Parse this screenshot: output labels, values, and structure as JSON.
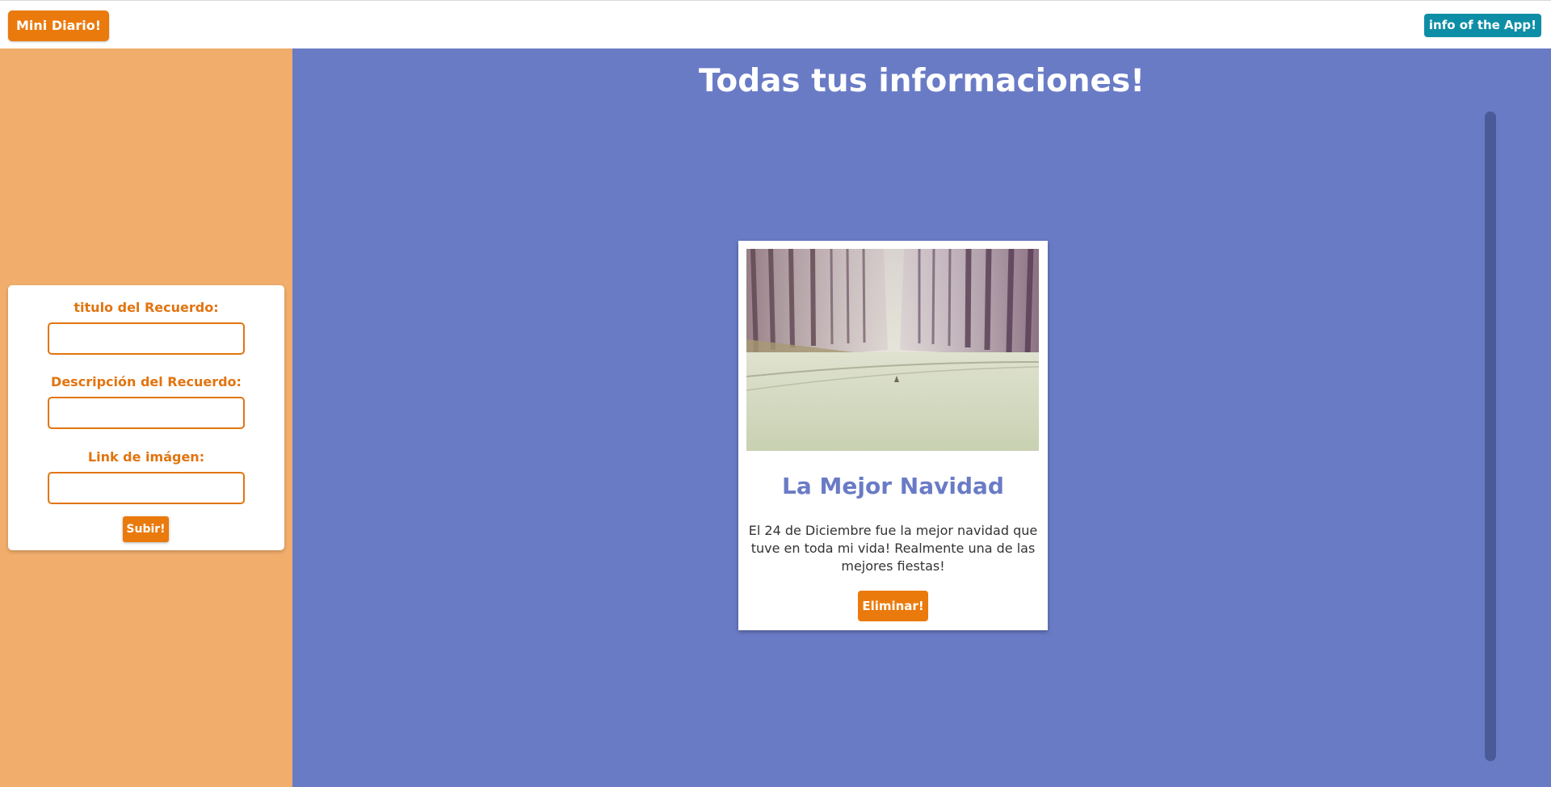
{
  "header": {
    "brand_label": "Mini Diario!",
    "info_label": "info of the App!"
  },
  "form": {
    "title_label": "titulo del Recuerdo:",
    "title_value": "",
    "description_label": "Descripción del Recuerdo:",
    "description_value": "",
    "image_link_label": "Link de imágen:",
    "image_link_value": "",
    "submit_label": "Subir!"
  },
  "main": {
    "heading": "Todas tus informaciones!",
    "cards": [
      {
        "title": "La Mejor Navidad",
        "description": "El 24 de Diciembre fue la mejor navidad que tuve en toda mi vida! Realmente una de las mejores fiestas!",
        "delete_label": "Eliminar!",
        "image_icon": "misty-forest-road-photo"
      }
    ]
  },
  "colors": {
    "accent_orange": "#ea7a0c",
    "info_teal": "#0e8ea6",
    "sidebar_bg": "#f0ad6b",
    "main_bg": "#6a7bc6",
    "card_title": "#6a7bc6"
  }
}
